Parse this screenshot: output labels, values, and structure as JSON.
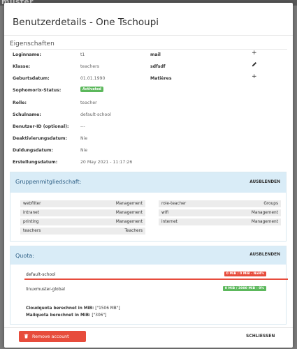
{
  "backdrop": {
    "logo_text": "muster"
  },
  "dialog": {
    "title": "Benutzerdetails - One Tschoupi",
    "section_title": "Eigenschaften"
  },
  "properties": [
    {
      "label": "Loginname:",
      "value": "t1"
    },
    {
      "label": "Klasse:",
      "value": "teachers"
    },
    {
      "label": "Geburtsdatum:",
      "value": "01.01.1990"
    },
    {
      "label": "Sophomorix-Status:",
      "value": "Activated",
      "badge_color": "#5cb85c"
    },
    {
      "label": "Rolle:",
      "value": "teacher"
    },
    {
      "label": "Schulname:",
      "value": "default-school"
    },
    {
      "label": "Benutzer-ID (optional):",
      "value": "---"
    },
    {
      "label": "Deaktivierungsdatum:",
      "value": "Nie"
    },
    {
      "label": "Duldungsdatum:",
      "value": "Nie"
    },
    {
      "label": "Erstellungsdatum:",
      "value": "20 May 2021 - 11:17:26"
    }
  ],
  "side_fields": [
    {
      "label": "mail",
      "icon": "plus-icon"
    },
    {
      "label": "sdfsdf",
      "icon": "pencil-icon"
    },
    {
      "label": "Matières",
      "icon": "plus-icon"
    }
  ],
  "groups_panel": {
    "title": "Gruppenmitgliedschaft:",
    "hide_label": "AUSBLENDEN",
    "left": [
      {
        "name": "webfilter",
        "type": "Management"
      },
      {
        "name": "intranet",
        "type": "Management"
      },
      {
        "name": "printing",
        "type": "Management"
      },
      {
        "name": "teachers",
        "type": "Teachers"
      }
    ],
    "right": [
      {
        "name": "role-teacher",
        "type": "Groups"
      },
      {
        "name": "wifi",
        "type": "Management"
      },
      {
        "name": "internet",
        "type": "Management"
      }
    ]
  },
  "quota_panel": {
    "title": "Quota:",
    "hide_label": "AUSBLENDEN",
    "items": [
      {
        "name": "default-school",
        "badge": "0 MiB / 0 MiB - NaN%",
        "color": "#e74c3c"
      },
      {
        "name": "linuxmuster-global",
        "badge": "0 MiB / 3000 MiB - 0%",
        "color": "#5cb85c"
      }
    ],
    "notes": [
      {
        "label": "Cloudquota berechnet in MiB:",
        "value": " [\"1506 MB\"]"
      },
      {
        "label": "Mailquota berechnet in MiB:",
        "value": " [\"306\"]"
      }
    ]
  },
  "footer": {
    "remove_label": "Remove account",
    "close_label": "SCHLIESSEN"
  }
}
